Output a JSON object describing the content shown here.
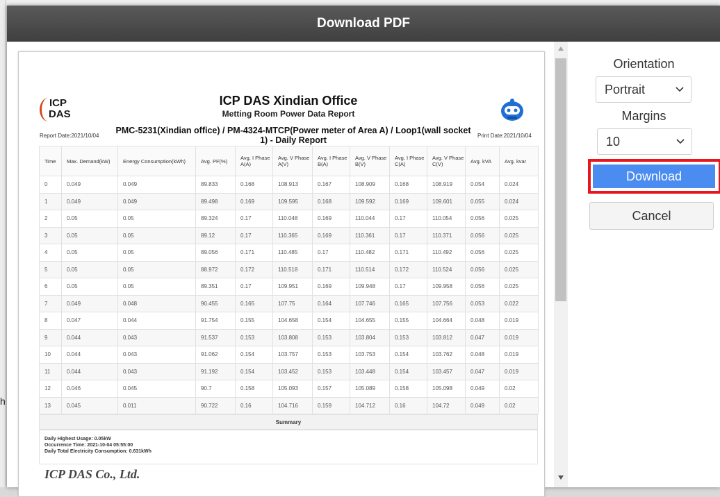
{
  "dialog": {
    "title": "Download PDF"
  },
  "report": {
    "company": "ICP DAS Xindian Office",
    "subtitle": "Metting Room Power Data Report",
    "logo_line1": "ICP",
    "logo_line2": "DAS",
    "report_date": "Report Date:2021/10/04",
    "print_date": "Print Date:2021/10/04",
    "heading": "PMC-5231(Xindian office) / PM-4324-MTCP(Power meter of Area A) / Loop1(wall socket 1) - Daily Report",
    "columns": [
      "Time",
      "Max. Demand(kW)",
      "Energy Consumption(kWh)",
      "Avg. PF(%)",
      "Avg. I Phase A(A)",
      "Avg. V Phase A(V)",
      "Avg. I Phase B(A)",
      "Avg. V Phase B(V)",
      "Avg. I Phase C(A)",
      "Avg. V Phase C(V)",
      "Avg. kVA",
      "Avg. kvar"
    ],
    "rows": [
      [
        "0",
        "0.049",
        "0.049",
        "89.833",
        "0.168",
        "108.913",
        "0.167",
        "108.909",
        "0.168",
        "108.919",
        "0.054",
        "0.024"
      ],
      [
        "1",
        "0.049",
        "0.049",
        "89.498",
        "0.169",
        "109.595",
        "0.168",
        "109.592",
        "0.169",
        "109.601",
        "0.055",
        "0.024"
      ],
      [
        "2",
        "0.05",
        "0.05",
        "89.324",
        "0.17",
        "110.048",
        "0.169",
        "110.044",
        "0.17",
        "110.054",
        "0.056",
        "0.025"
      ],
      [
        "3",
        "0.05",
        "0.05",
        "89.12",
        "0.17",
        "110.365",
        "0.169",
        "110.361",
        "0.17",
        "110.371",
        "0.056",
        "0.025"
      ],
      [
        "4",
        "0.05",
        "0.05",
        "89.056",
        "0.171",
        "110.485",
        "0.17",
        "110.482",
        "0.171",
        "110.492",
        "0.056",
        "0.025"
      ],
      [
        "5",
        "0.05",
        "0.05",
        "88.972",
        "0.172",
        "110.518",
        "0.171",
        "110.514",
        "0.172",
        "110.524",
        "0.056",
        "0.025"
      ],
      [
        "6",
        "0.05",
        "0.05",
        "89.351",
        "0.17",
        "109.951",
        "0.169",
        "109.948",
        "0.17",
        "109.958",
        "0.056",
        "0.025"
      ],
      [
        "7",
        "0.049",
        "0.048",
        "90.455",
        "0.165",
        "107.75",
        "0.164",
        "107.746",
        "0.165",
        "107.756",
        "0.053",
        "0.022"
      ],
      [
        "8",
        "0.047",
        "0.044",
        "91.754",
        "0.155",
        "104.658",
        "0.154",
        "104.655",
        "0.155",
        "104.664",
        "0.048",
        "0.019"
      ],
      [
        "9",
        "0.044",
        "0.043",
        "91.537",
        "0.153",
        "103.808",
        "0.153",
        "103.804",
        "0.153",
        "103.812",
        "0.047",
        "0.019"
      ],
      [
        "10",
        "0.044",
        "0.043",
        "91.062",
        "0.154",
        "103.757",
        "0.153",
        "103.753",
        "0.154",
        "103.762",
        "0.048",
        "0.019"
      ],
      [
        "11",
        "0.044",
        "0.043",
        "91.192",
        "0.154",
        "103.452",
        "0.153",
        "103.448",
        "0.154",
        "103.457",
        "0.047",
        "0.019"
      ],
      [
        "12",
        "0.046",
        "0.045",
        "90.7",
        "0.158",
        "105.093",
        "0.157",
        "105.089",
        "0.158",
        "105.098",
        "0.049",
        "0.02"
      ],
      [
        "13",
        "0.045",
        "0.011",
        "90.722",
        "0.16",
        "104.716",
        "0.159",
        "104.712",
        "0.16",
        "104.72",
        "0.049",
        "0.02"
      ]
    ],
    "summary_label": "Summary",
    "summary_lines": [
      "Daily Highest Usage: 0.05kW",
      "Occurrence Time: 2021-10-04 05:55:00",
      "Daily Total Electricity Consumption: 0.631kWh"
    ],
    "footer_company": "ICP DAS Co., Ltd."
  },
  "options": {
    "orientation_label": "Orientation",
    "orientation_value": "Portrait",
    "margins_label": "Margins",
    "margins_value": "10",
    "download_label": "Download",
    "cancel_label": "Cancel"
  },
  "background": {
    "ghost_char": "h"
  },
  "colors": {
    "titlebar": "#4a4a4a",
    "download_button": "#4a8cf0",
    "highlight_border": "#e8151c",
    "logo_arc": "#d04a1a",
    "robot_icon": "#1f6fd6"
  },
  "icons": [
    "icp-das-logo",
    "robot-icon",
    "chevron-down-icon",
    "scroll-up-icon",
    "scroll-down-icon"
  ]
}
